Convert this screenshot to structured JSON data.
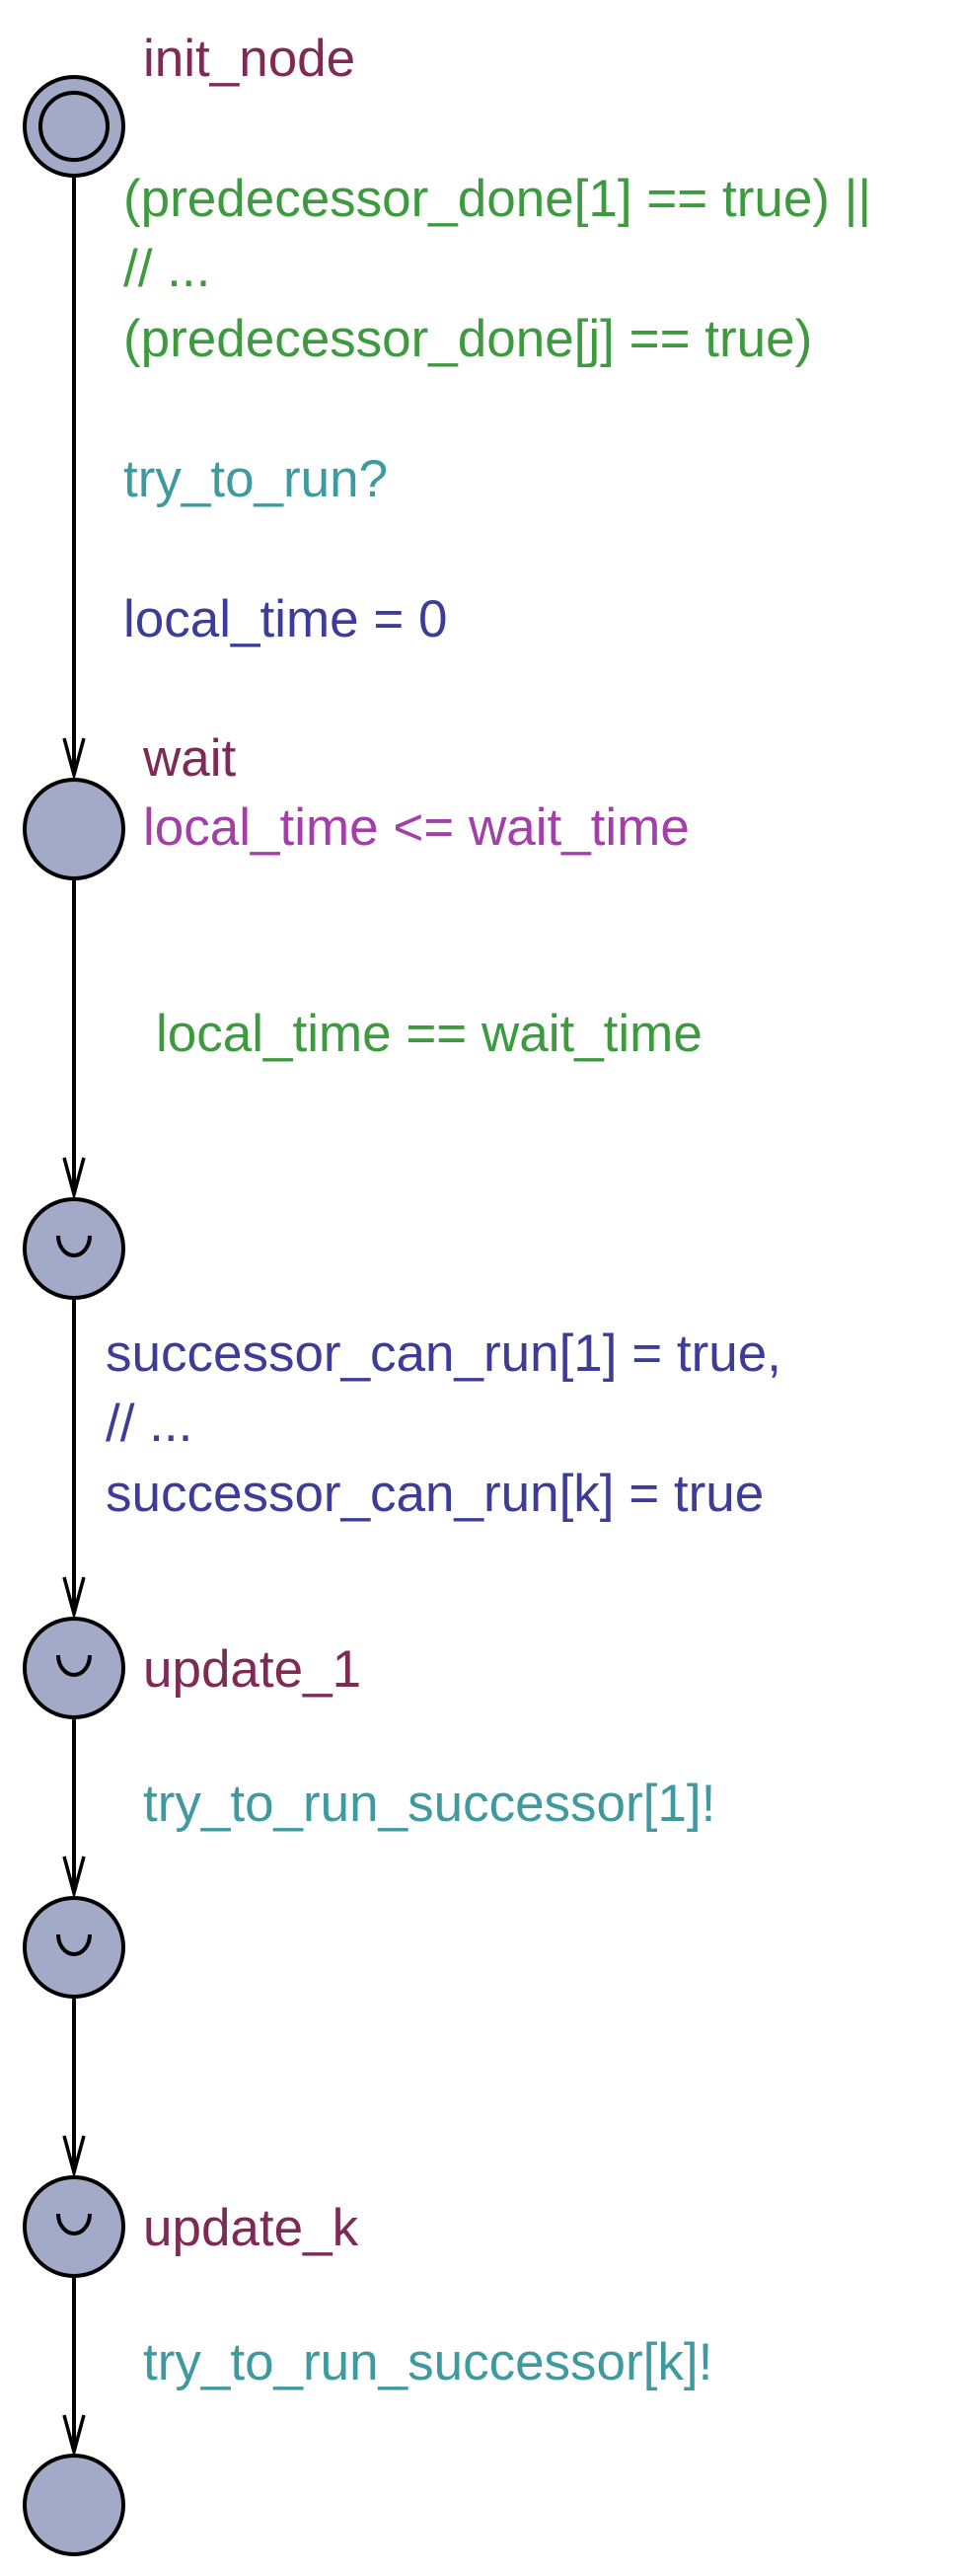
{
  "colors": {
    "location_fill": "#a3aac8",
    "location_stroke": "#000000",
    "edge": "#000000",
    "name": "#7d2a55",
    "guard": "#3e9a3e",
    "sync": "#3f9aa0",
    "update": "#3d3d98",
    "invariant": "#a33fa8"
  },
  "locations": [
    {
      "id": "init_node",
      "name": "init_node",
      "kind": "initial"
    },
    {
      "id": "wait",
      "name": "wait",
      "kind": "normal",
      "invariant": "local_time <= wait_time"
    },
    {
      "id": "committed_1",
      "name": "",
      "kind": "committed"
    },
    {
      "id": "update_1",
      "name": "update_1",
      "kind": "committed"
    },
    {
      "id": "committed_2",
      "name": "",
      "kind": "committed"
    },
    {
      "id": "update_k",
      "name": "update_k",
      "kind": "committed"
    },
    {
      "id": "end",
      "name": "",
      "kind": "normal"
    }
  ],
  "edges": [
    {
      "from": "init_node",
      "to": "wait",
      "guard": [
        "(predecessor_done[1] == true) ||",
        "// ...",
        "(predecessor_done[j] == true)"
      ],
      "sync": "try_to_run?",
      "update": "local_time = 0"
    },
    {
      "from": "wait",
      "to": "committed_1",
      "guard": "local_time == wait_time"
    },
    {
      "from": "committed_1",
      "to": "update_1",
      "update": [
        "successor_can_run[1] = true,",
        "// ...",
        "successor_can_run[k] = true"
      ]
    },
    {
      "from": "update_1",
      "to": "committed_2",
      "sync": "try_to_run_successor[1]!"
    },
    {
      "from": "committed_2",
      "to": "update_k"
    },
    {
      "from": "update_k",
      "to": "end",
      "sync": "try_to_run_successor[k]!"
    }
  ]
}
